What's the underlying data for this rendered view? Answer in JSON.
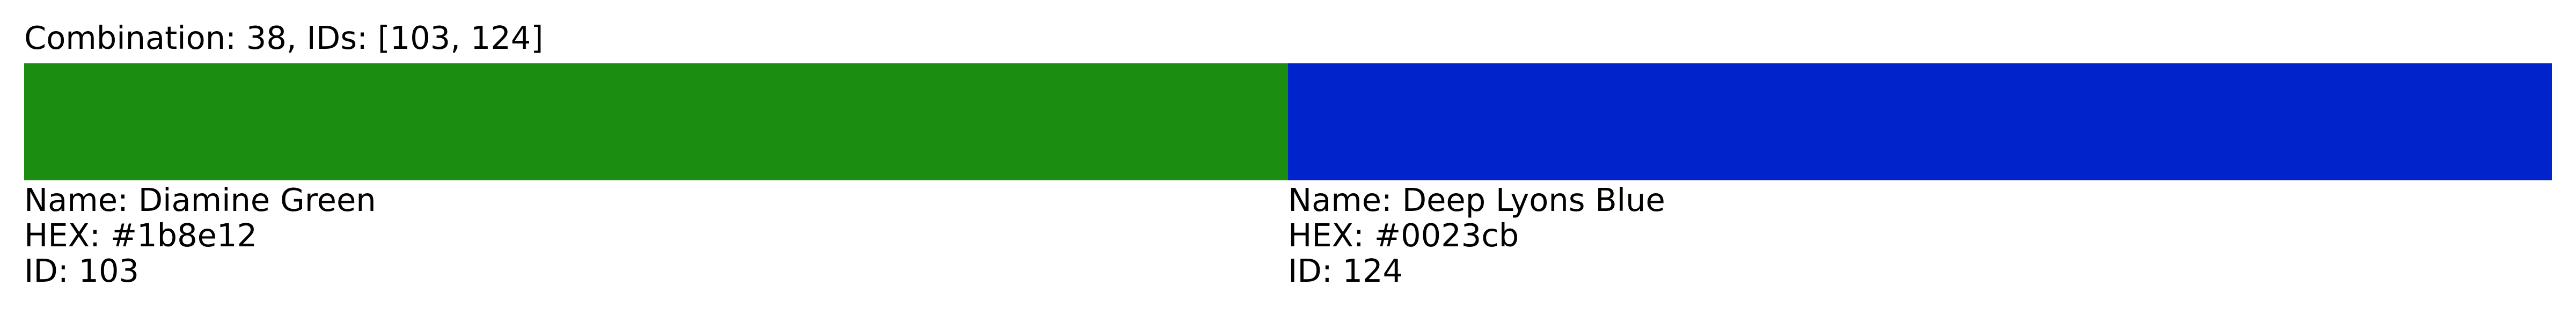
{
  "title": "Combination: 38, IDs: [103, 124]",
  "colors": [
    {
      "name_line": "Name: Diamine Green",
      "hex_line": "HEX: #1b8e12",
      "id_line": "ID: 103",
      "hex": "#1b8e12"
    },
    {
      "name_line": "Name: Deep Lyons Blue",
      "hex_line": "HEX: #0023cb",
      "id_line": "ID: 124",
      "hex": "#0023cb"
    }
  ]
}
